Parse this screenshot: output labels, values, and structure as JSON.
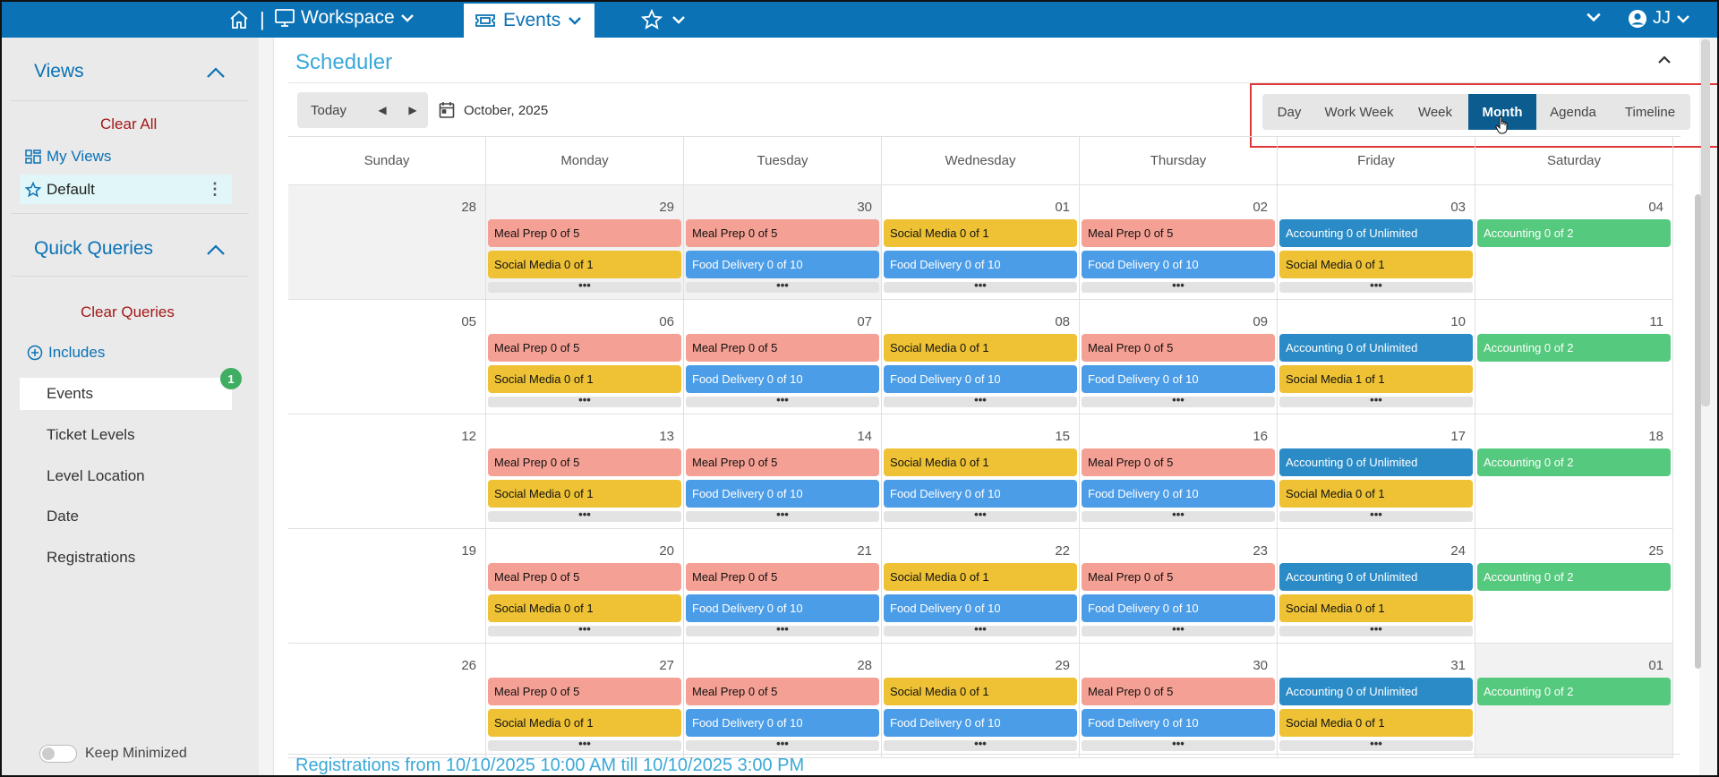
{
  "topnav": {
    "workspace_label": "Workspace",
    "events_label": "Events",
    "user_initials": "JJ"
  },
  "sidebar": {
    "views_title": "Views",
    "clear_all": "Clear All",
    "my_views": "My Views",
    "default_view": "Default",
    "quick_queries_title": "Quick Queries",
    "clear_queries": "Clear Queries",
    "includes": "Includes",
    "items": [
      "Events",
      "Ticket Levels",
      "Level Location",
      "Date",
      "Registrations"
    ],
    "events_badge": "1",
    "keep_minimized": "Keep Minimized"
  },
  "scheduler": {
    "title": "Scheduler",
    "today": "Today",
    "current_period": "October, 2025",
    "views": [
      "Day",
      "Work Week",
      "Week",
      "Month",
      "Agenda",
      "Timeline"
    ],
    "active_view": "Month",
    "weekdays": [
      "Sunday",
      "Monday",
      "Tuesday",
      "Wednesday",
      "Thursday",
      "Friday",
      "Saturday"
    ],
    "footer_text": "Registrations from 10/10/2025 10:00 AM till 10/10/2025 3:00 PM",
    "weeks": [
      {
        "days": [
          {
            "d": "28",
            "other": true,
            "events": [],
            "more": false
          },
          {
            "d": "29",
            "other": true,
            "events": [
              {
                "t": "Meal Prep 0 of 5",
                "c": "meal"
              },
              {
                "t": "Social Media 0 of 1",
                "c": "social"
              }
            ],
            "more": true
          },
          {
            "d": "30",
            "other": true,
            "events": [
              {
                "t": "Meal Prep 0 of 5",
                "c": "meal"
              },
              {
                "t": "Food Delivery 0 of 10",
                "c": "food"
              }
            ],
            "more": true
          },
          {
            "d": "01",
            "other": false,
            "events": [
              {
                "t": "Social Media 0 of 1",
                "c": "social"
              },
              {
                "t": "Food Delivery 0 of 10",
                "c": "food"
              }
            ],
            "more": true
          },
          {
            "d": "02",
            "other": false,
            "events": [
              {
                "t": "Meal Prep 0 of 5",
                "c": "meal"
              },
              {
                "t": "Food Delivery 0 of 10",
                "c": "food"
              }
            ],
            "more": true
          },
          {
            "d": "03",
            "other": false,
            "events": [
              {
                "t": "Accounting 0 of Unlimited",
                "c": "acct"
              },
              {
                "t": "Social Media 0 of 1",
                "c": "social"
              }
            ],
            "more": true
          },
          {
            "d": "04",
            "other": false,
            "events": [
              {
                "t": "Accounting 0 of 2",
                "c": "acct2"
              }
            ],
            "more": false
          }
        ]
      },
      {
        "days": [
          {
            "d": "05",
            "other": false,
            "events": [],
            "more": false
          },
          {
            "d": "06",
            "other": false,
            "events": [
              {
                "t": "Meal Prep 0 of 5",
                "c": "meal"
              },
              {
                "t": "Social Media 0 of 1",
                "c": "social"
              }
            ],
            "more": true
          },
          {
            "d": "07",
            "other": false,
            "events": [
              {
                "t": "Meal Prep 0 of 5",
                "c": "meal"
              },
              {
                "t": "Food Delivery 0 of 10",
                "c": "food"
              }
            ],
            "more": true
          },
          {
            "d": "08",
            "other": false,
            "events": [
              {
                "t": "Social Media 0 of 1",
                "c": "social"
              },
              {
                "t": "Food Delivery 0 of 10",
                "c": "food"
              }
            ],
            "more": true
          },
          {
            "d": "09",
            "other": false,
            "events": [
              {
                "t": "Meal Prep 0 of 5",
                "c": "meal"
              },
              {
                "t": "Food Delivery 0 of 10",
                "c": "food"
              }
            ],
            "more": true
          },
          {
            "d": "10",
            "other": false,
            "events": [
              {
                "t": "Accounting 0 of Unlimited",
                "c": "acct"
              },
              {
                "t": "Social Media 1 of 1",
                "c": "social"
              }
            ],
            "more": true
          },
          {
            "d": "11",
            "other": false,
            "events": [
              {
                "t": "Accounting 0 of 2",
                "c": "acct2"
              }
            ],
            "more": false
          }
        ]
      },
      {
        "days": [
          {
            "d": "12",
            "other": false,
            "events": [],
            "more": false
          },
          {
            "d": "13",
            "other": false,
            "events": [
              {
                "t": "Meal Prep 0 of 5",
                "c": "meal"
              },
              {
                "t": "Social Media 0 of 1",
                "c": "social"
              }
            ],
            "more": true
          },
          {
            "d": "14",
            "other": false,
            "events": [
              {
                "t": "Meal Prep 0 of 5",
                "c": "meal"
              },
              {
                "t": "Food Delivery 0 of 10",
                "c": "food"
              }
            ],
            "more": true
          },
          {
            "d": "15",
            "other": false,
            "events": [
              {
                "t": "Social Media 0 of 1",
                "c": "social"
              },
              {
                "t": "Food Delivery 0 of 10",
                "c": "food"
              }
            ],
            "more": true
          },
          {
            "d": "16",
            "other": false,
            "events": [
              {
                "t": "Meal Prep 0 of 5",
                "c": "meal"
              },
              {
                "t": "Food Delivery 0 of 10",
                "c": "food"
              }
            ],
            "more": true
          },
          {
            "d": "17",
            "other": false,
            "events": [
              {
                "t": "Accounting 0 of Unlimited",
                "c": "acct"
              },
              {
                "t": "Social Media 0 of 1",
                "c": "social"
              }
            ],
            "more": true
          },
          {
            "d": "18",
            "other": false,
            "events": [
              {
                "t": "Accounting 0 of 2",
                "c": "acct2"
              }
            ],
            "more": false
          }
        ]
      },
      {
        "days": [
          {
            "d": "19",
            "other": false,
            "events": [],
            "more": false
          },
          {
            "d": "20",
            "other": false,
            "events": [
              {
                "t": "Meal Prep 0 of 5",
                "c": "meal"
              },
              {
                "t": "Social Media 0 of 1",
                "c": "social"
              }
            ],
            "more": true
          },
          {
            "d": "21",
            "other": false,
            "events": [
              {
                "t": "Meal Prep 0 of 5",
                "c": "meal"
              },
              {
                "t": "Food Delivery 0 of 10",
                "c": "food"
              }
            ],
            "more": true
          },
          {
            "d": "22",
            "other": false,
            "events": [
              {
                "t": "Social Media 0 of 1",
                "c": "social"
              },
              {
                "t": "Food Delivery 0 of 10",
                "c": "food"
              }
            ],
            "more": true
          },
          {
            "d": "23",
            "other": false,
            "events": [
              {
                "t": "Meal Prep 0 of 5",
                "c": "meal"
              },
              {
                "t": "Food Delivery 0 of 10",
                "c": "food"
              }
            ],
            "more": true
          },
          {
            "d": "24",
            "other": false,
            "events": [
              {
                "t": "Accounting 0 of Unlimited",
                "c": "acct"
              },
              {
                "t": "Social Media 0 of 1",
                "c": "social"
              }
            ],
            "more": true
          },
          {
            "d": "25",
            "other": false,
            "events": [
              {
                "t": "Accounting 0 of 2",
                "c": "acct2"
              }
            ],
            "more": false
          }
        ]
      },
      {
        "days": [
          {
            "d": "26",
            "other": false,
            "events": [],
            "more": false
          },
          {
            "d": "27",
            "other": false,
            "events": [
              {
                "t": "Meal Prep 0 of 5",
                "c": "meal"
              },
              {
                "t": "Social Media 0 of 1",
                "c": "social"
              }
            ],
            "more": true
          },
          {
            "d": "28",
            "other": false,
            "events": [
              {
                "t": "Meal Prep 0 of 5",
                "c": "meal"
              },
              {
                "t": "Food Delivery 0 of 10",
                "c": "food"
              }
            ],
            "more": true
          },
          {
            "d": "29",
            "other": false,
            "events": [
              {
                "t": "Social Media 0 of 1",
                "c": "social"
              },
              {
                "t": "Food Delivery 0 of 10",
                "c": "food"
              }
            ],
            "more": true
          },
          {
            "d": "30",
            "other": false,
            "events": [
              {
                "t": "Meal Prep 0 of 5",
                "c": "meal"
              },
              {
                "t": "Food Delivery 0 of 10",
                "c": "food"
              }
            ],
            "more": true
          },
          {
            "d": "31",
            "other": false,
            "events": [
              {
                "t": "Accounting 0 of Unlimited",
                "c": "acct"
              },
              {
                "t": "Social Media 0 of 1",
                "c": "social"
              }
            ],
            "more": true
          },
          {
            "d": "01",
            "other": true,
            "events": [
              {
                "t": "Accounting 0 of 2",
                "c": "acct2"
              }
            ],
            "more": false
          }
        ]
      }
    ]
  },
  "colors": {
    "nav": "#0a72b5",
    "meal": "#f5a094",
    "social": "#eec234",
    "food": "#4b9de8",
    "accounting": "#2a8bc6",
    "accounting_alt": "#55c97d",
    "active_view": "#0c5c8f",
    "highlight_box": "#e03838"
  }
}
